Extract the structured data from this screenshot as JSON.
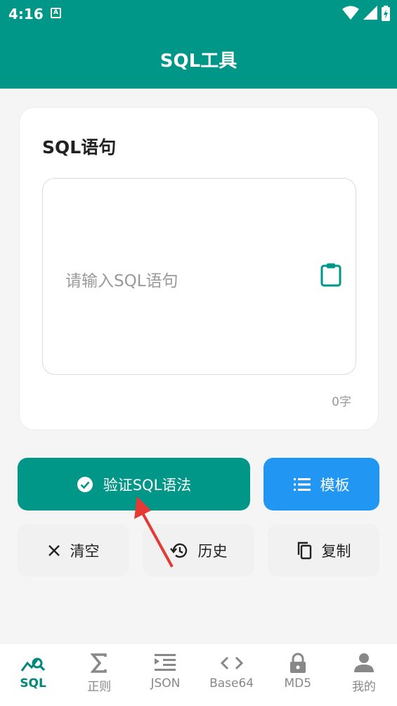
{
  "status_bar": {
    "time": "4:16",
    "notification_letter": "A",
    "icons": [
      "wifi-icon",
      "signal-icon",
      "battery-icon"
    ]
  },
  "header": {
    "title": "SQL工具"
  },
  "card": {
    "title": "SQL语句",
    "input_placeholder": "请输入SQL语句",
    "input_value": "",
    "char_count": "0字"
  },
  "actions": {
    "validate_label": "验证SQL语法",
    "template_label": "模板",
    "clear_label": "清空",
    "history_label": "历史",
    "copy_label": "复制"
  },
  "bottom_nav": {
    "items": [
      {
        "label": "SQL",
        "icon": "sql-chart-icon",
        "active": true
      },
      {
        "label": "正则",
        "icon": "sigma-icon",
        "active": false
      },
      {
        "label": "JSON",
        "icon": "indent-icon",
        "active": false
      },
      {
        "label": "Base64",
        "icon": "code-icon",
        "active": false
      },
      {
        "label": "MD5",
        "icon": "lock-icon",
        "active": false
      },
      {
        "label": "我的",
        "icon": "person-icon",
        "active": false
      }
    ]
  },
  "colors": {
    "primary": "#009688",
    "template_button": "#2196f3",
    "secondary_button": "#f1f1f1",
    "annotation_arrow": "#e53935"
  }
}
